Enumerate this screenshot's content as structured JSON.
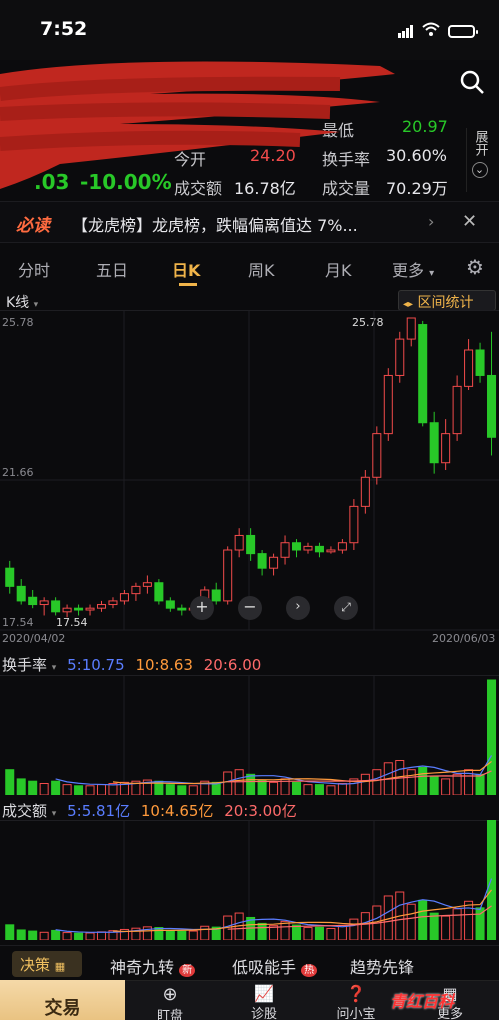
{
  "status": {
    "time": "7:52"
  },
  "quote": {
    "change_pct": "-10.00%",
    "price_suffix": ".03",
    "open_label": "今开",
    "open_value": "24.20",
    "turnover_label": "成交额",
    "turnover_value": "16.78亿",
    "low_label": "最低",
    "low_value": "20.97",
    "turnover_rate_label": "换手率",
    "turnover_rate_value": "30.60%",
    "volume_label": "成交量",
    "volume_value": "70.29万",
    "expand_label": "展开"
  },
  "news": {
    "tag": "必读",
    "text": "【龙虎榜】龙虎榜，跌幅偏离值达 7%..."
  },
  "tabs": [
    "分时",
    "五日",
    "日K",
    "周K",
    "月K",
    "更多"
  ],
  "active_tab": "日K",
  "kline": {
    "label": "K线",
    "range_stats": "区间统计",
    "y_high": "25.78",
    "y_mid": "21.66",
    "y_low": "17.54",
    "max_marker": "25.78",
    "min_marker": "17.54",
    "date_start": "2020/04/02",
    "date_end": "2020/06/03"
  },
  "turnover_indicator": {
    "label": "换手率",
    "ma5": "5:10.75",
    "ma10": "10:8.63",
    "ma20": "20:6.00"
  },
  "volume_indicator": {
    "label": "成交额",
    "ma5": "5:5.81亿",
    "ma10": "10:4.65亿",
    "ma20": "20:3.00亿"
  },
  "decision": {
    "tag": "决策",
    "items": [
      "神奇九转",
      "低吸能手",
      "趋势先锋"
    ],
    "badge_new": "新",
    "badge_hot": "热"
  },
  "bottom_nav": {
    "trade": "交易",
    "items": [
      "盯盘",
      "诊股",
      "问小宝",
      "更多"
    ]
  },
  "watermark": "青红百科",
  "colors": {
    "up": "#f24b4b",
    "down": "#28c828",
    "accent": "#f0b44a"
  }
}
